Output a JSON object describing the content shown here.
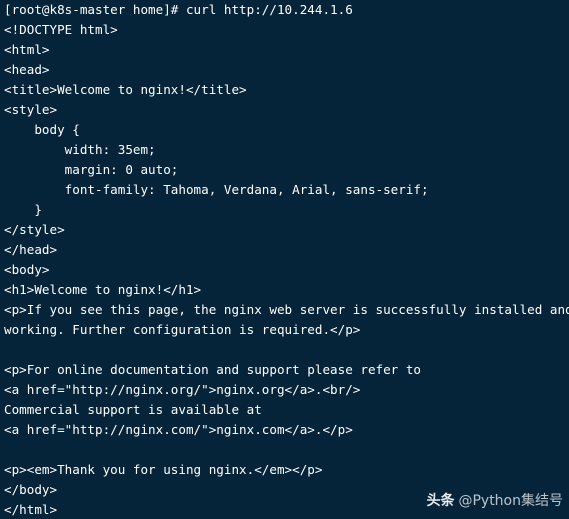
{
  "terminal": {
    "background": "#05243a",
    "foreground": "#ffffff",
    "lines": [
      "[root@k8s-master home]# curl http://10.244.1.6",
      "<!DOCTYPE html>",
      "<html>",
      "<head>",
      "<title>Welcome to nginx!</title>",
      "<style>",
      "    body {",
      "        width: 35em;",
      "        margin: 0 auto;",
      "        font-family: Tahoma, Verdana, Arial, sans-serif;",
      "    }",
      "</style>",
      "</head>",
      "<body>",
      "<h1>Welcome to nginx!</h1>",
      "<p>If you see this page, the nginx web server is successfully installed and",
      "working. Further configuration is required.</p>",
      "",
      "<p>For online documentation and support please refer to",
      "<a href=\"http://nginx.org/\">nginx.org</a>.<br/>",
      "Commercial support is available at",
      "<a href=\"http://nginx.com/\">nginx.com</a>.</p>",
      "",
      "<p><em>Thank you for using nginx.</em></p>",
      "</body>",
      "</html>"
    ]
  },
  "watermark": {
    "brand": "头条",
    "handle": "@Python集结号"
  }
}
